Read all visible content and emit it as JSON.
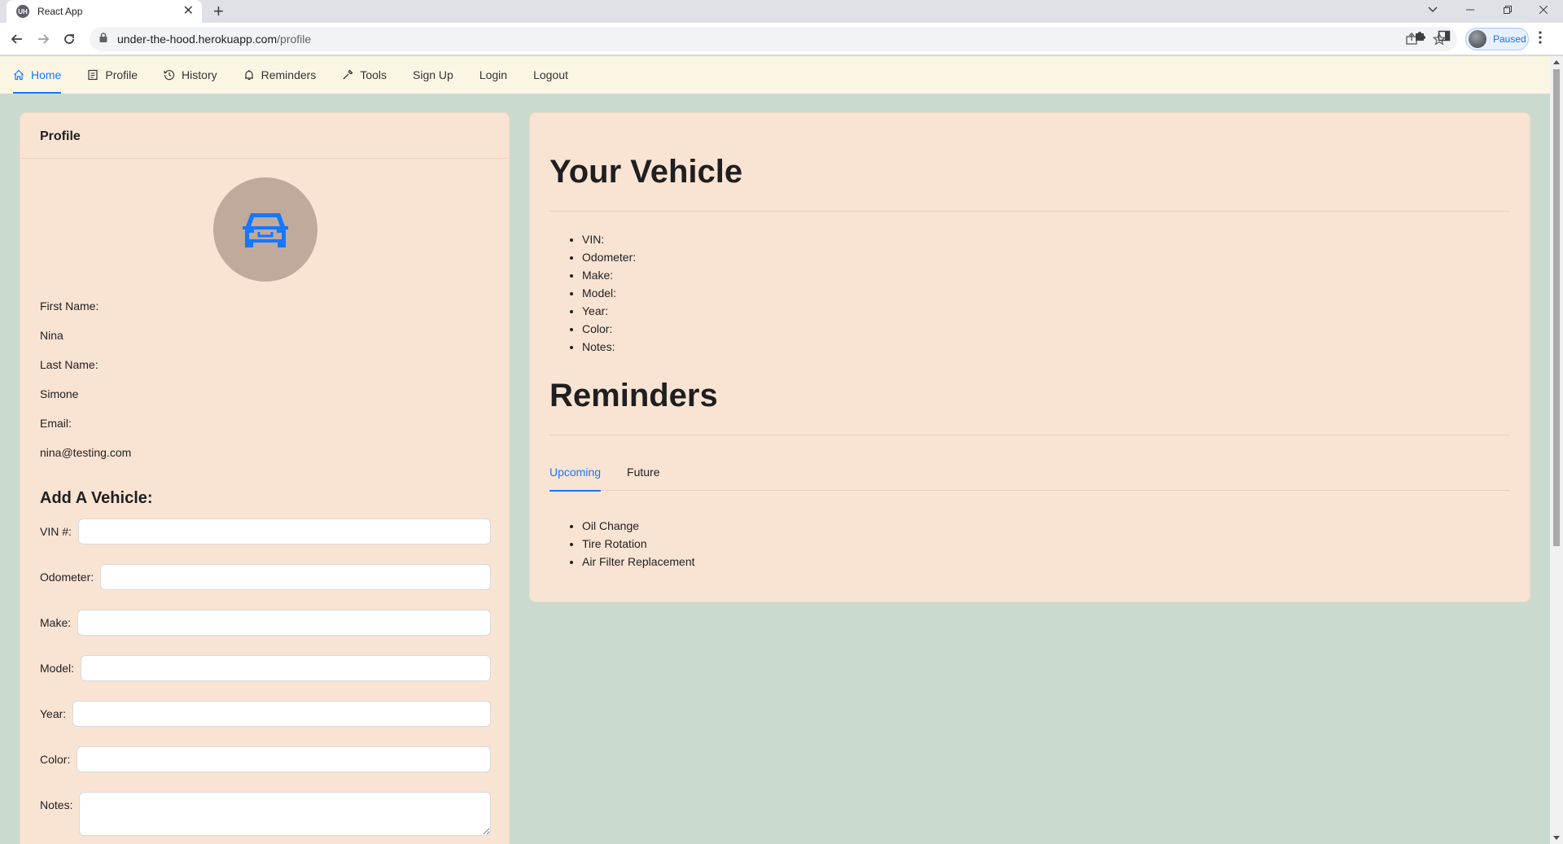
{
  "browser": {
    "tab_title": "React App",
    "tab_favicon_text": "UH",
    "url_host": "under-the-hood.herokuapp.com",
    "url_path": "/profile",
    "profile_status": "Paused"
  },
  "nav": {
    "items": [
      {
        "label": "Home",
        "icon": "home-icon",
        "active": true
      },
      {
        "label": "Profile",
        "icon": "profile-icon",
        "active": false
      },
      {
        "label": "History",
        "icon": "history-icon",
        "active": false
      },
      {
        "label": "Reminders",
        "icon": "reminders-icon",
        "active": false
      },
      {
        "label": "Tools",
        "icon": "tools-icon",
        "active": false
      },
      {
        "label": "Sign Up",
        "icon": null,
        "active": false
      },
      {
        "label": "Login",
        "icon": null,
        "active": false
      },
      {
        "label": "Logout",
        "icon": null,
        "active": false
      }
    ]
  },
  "profile": {
    "title": "Profile",
    "avatar_icon": "car-icon",
    "first_name_label": "First Name:",
    "first_name": "Nina",
    "last_name_label": "Last Name:",
    "last_name": "Simone",
    "email_label": "Email:",
    "email": "nina@testing.com",
    "add_vehicle_title": "Add A Vehicle:",
    "fields": [
      {
        "label": "VIN #:",
        "value": ""
      },
      {
        "label": "Odometer:",
        "value": ""
      },
      {
        "label": "Make:",
        "value": ""
      },
      {
        "label": "Model:",
        "value": ""
      },
      {
        "label": "Year:",
        "value": ""
      },
      {
        "label": "Color:",
        "value": ""
      },
      {
        "label": "Notes:",
        "value": ""
      }
    ]
  },
  "vehicle": {
    "title": "Your Vehicle",
    "details": [
      "VIN:",
      "Odometer:",
      "Make:",
      "Model:",
      "Year:",
      "Color:",
      "Notes:"
    ]
  },
  "reminders": {
    "title": "Reminders",
    "tabs": [
      {
        "label": "Upcoming",
        "active": true
      },
      {
        "label": "Future",
        "active": false
      }
    ],
    "items": [
      "Oil Change",
      "Tire Rotation",
      "Air Filter Replacement"
    ]
  },
  "colors": {
    "page_bg": "#cbdacf",
    "nav_bg": "#fbf6e4",
    "card_bg": "#f9e3d3",
    "accent": "#1677ff",
    "avatar_bg": "#bfaa9c"
  }
}
